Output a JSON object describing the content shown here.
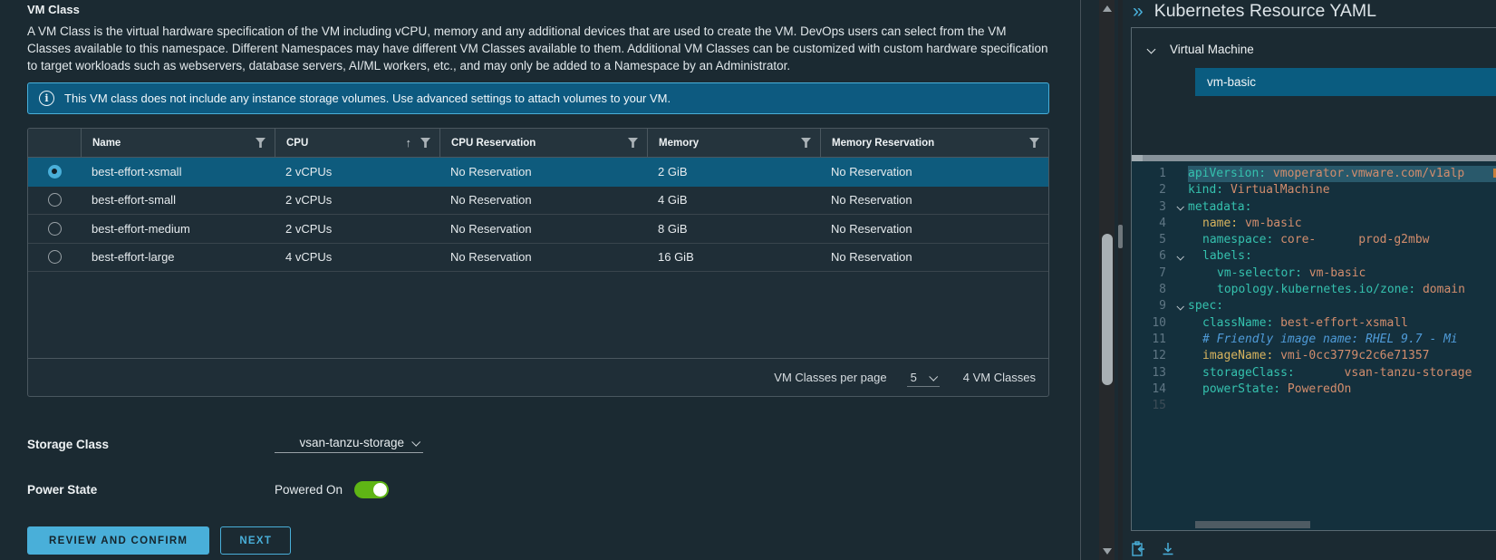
{
  "vm_class_section": {
    "title": "VM Class",
    "description": "A VM Class is the virtual hardware specification of the VM including vCPU, memory and any additional devices that are used to create the VM. DevOps users can select from the VM Classes available to this namespace. Different Namespaces may have different VM Classes available to them. Additional VM Classes can be customized with custom hardware specification to target workloads such as webservers, database servers, AI/ML workers, etc., and may only be added to a Namespace by an Administrator.",
    "info_banner": "This VM class does not include any instance storage volumes. Use advanced settings to attach volumes to your VM.",
    "info_icon_glyph": "i"
  },
  "table": {
    "columns": [
      "Name",
      "CPU",
      "CPU Reservation",
      "Memory",
      "Memory Reservation"
    ],
    "sorted_column": "CPU",
    "sort_icon_glyph": "↑",
    "rows": [
      {
        "name": "best-effort-xsmall",
        "cpu": "2 vCPUs",
        "cpu_reservation": "No Reservation",
        "memory": "2 GiB",
        "memory_reservation": "No Reservation",
        "selected": true
      },
      {
        "name": "best-effort-small",
        "cpu": "2 vCPUs",
        "cpu_reservation": "No Reservation",
        "memory": "4 GiB",
        "memory_reservation": "No Reservation",
        "selected": false
      },
      {
        "name": "best-effort-medium",
        "cpu": "2 vCPUs",
        "cpu_reservation": "No Reservation",
        "memory": "8 GiB",
        "memory_reservation": "No Reservation",
        "selected": false
      },
      {
        "name": "best-effort-large",
        "cpu": "4 vCPUs",
        "cpu_reservation": "No Reservation",
        "memory": "16 GiB",
        "memory_reservation": "No Reservation",
        "selected": false
      }
    ],
    "footer": {
      "per_page_label": "VM Classes per page",
      "per_page_value": "5",
      "total_label": "4 VM Classes"
    }
  },
  "form": {
    "storage_class_label": "Storage Class",
    "storage_class_value": "vsan-tanzu-storage",
    "power_state_label": "Power State",
    "power_state_value": "Powered On",
    "power_state_on": true
  },
  "actions": {
    "review_and_confirm": "REVIEW AND CONFIRM",
    "next": "NEXT"
  },
  "yaml_panel": {
    "collapse_icon_glyph": "»",
    "title": "Kubernetes Resource YAML",
    "tree": {
      "group_label": "Virtual Machine",
      "selected_item": "vm-basic"
    },
    "code_lines": [
      {
        "num": "1",
        "indent": 0,
        "fold": false,
        "selected": true,
        "segments": [
          {
            "type": "key",
            "text": "apiVersion:"
          },
          {
            "type": "value",
            "text": " vmoperator.vmware.com/v1alp"
          }
        ]
      },
      {
        "num": "2",
        "indent": 0,
        "fold": false,
        "segments": [
          {
            "type": "key",
            "text": "kind:"
          },
          {
            "type": "value",
            "text": " VirtualMachine"
          }
        ]
      },
      {
        "num": "3",
        "indent": 0,
        "fold": true,
        "segments": [
          {
            "type": "key",
            "text": "metadata:"
          }
        ]
      },
      {
        "num": "4",
        "indent": 1,
        "fold": false,
        "segments": [
          {
            "type": "key-alt",
            "text": "name:"
          },
          {
            "type": "value",
            "text": " vm-basic"
          }
        ]
      },
      {
        "num": "5",
        "indent": 1,
        "fold": false,
        "segments": [
          {
            "type": "key",
            "text": "namespace:"
          },
          {
            "type": "value",
            "text": " core-      prod-g2mbw"
          }
        ]
      },
      {
        "num": "6",
        "indent": 1,
        "fold": true,
        "segments": [
          {
            "type": "key",
            "text": "labels:"
          }
        ]
      },
      {
        "num": "7",
        "indent": 2,
        "fold": false,
        "segments": [
          {
            "type": "key",
            "text": "vm-selector:"
          },
          {
            "type": "value",
            "text": " vm-basic"
          }
        ]
      },
      {
        "num": "8",
        "indent": 2,
        "fold": false,
        "segments": [
          {
            "type": "key",
            "text": "topology.kubernetes.io/zone:"
          },
          {
            "type": "value",
            "text": " domain"
          }
        ]
      },
      {
        "num": "9",
        "indent": 0,
        "fold": true,
        "segments": [
          {
            "type": "key",
            "text": "spec:"
          }
        ]
      },
      {
        "num": "10",
        "indent": 1,
        "fold": false,
        "segments": [
          {
            "type": "key",
            "text": "className:"
          },
          {
            "type": "value",
            "text": " best-effort-xsmall"
          }
        ]
      },
      {
        "num": "11",
        "indent": 1,
        "fold": false,
        "segments": [
          {
            "type": "comment",
            "text": "# Friendly image name: RHEL 9.7 - Mi"
          }
        ]
      },
      {
        "num": "12",
        "indent": 1,
        "fold": false,
        "segments": [
          {
            "type": "key-alt",
            "text": "imageName:"
          },
          {
            "type": "value",
            "text": " vmi-0cc3779c2c6e71357"
          }
        ]
      },
      {
        "num": "13",
        "indent": 1,
        "fold": false,
        "segments": [
          {
            "type": "key",
            "text": "storageClass:"
          },
          {
            "type": "value",
            "text": "       vsan-tanzu-storage"
          }
        ]
      },
      {
        "num": "14",
        "indent": 1,
        "fold": false,
        "segments": [
          {
            "type": "key",
            "text": "powerState:"
          },
          {
            "type": "value",
            "text": " PoweredOn"
          }
        ]
      },
      {
        "num": "15",
        "indent": 0,
        "fold": false,
        "dim": true,
        "segments": []
      }
    ]
  },
  "colors": {
    "accent_blue": "#49afd9",
    "banner_bg": "#0d5a80",
    "selected_row_bg": "#0e5b7d",
    "toggle_green": "#5fb515",
    "code_bg": "#14303d",
    "key_teal": "#35c1ae",
    "value_salmon": "#d28d6d",
    "comment_blue": "#4f9bd8"
  }
}
